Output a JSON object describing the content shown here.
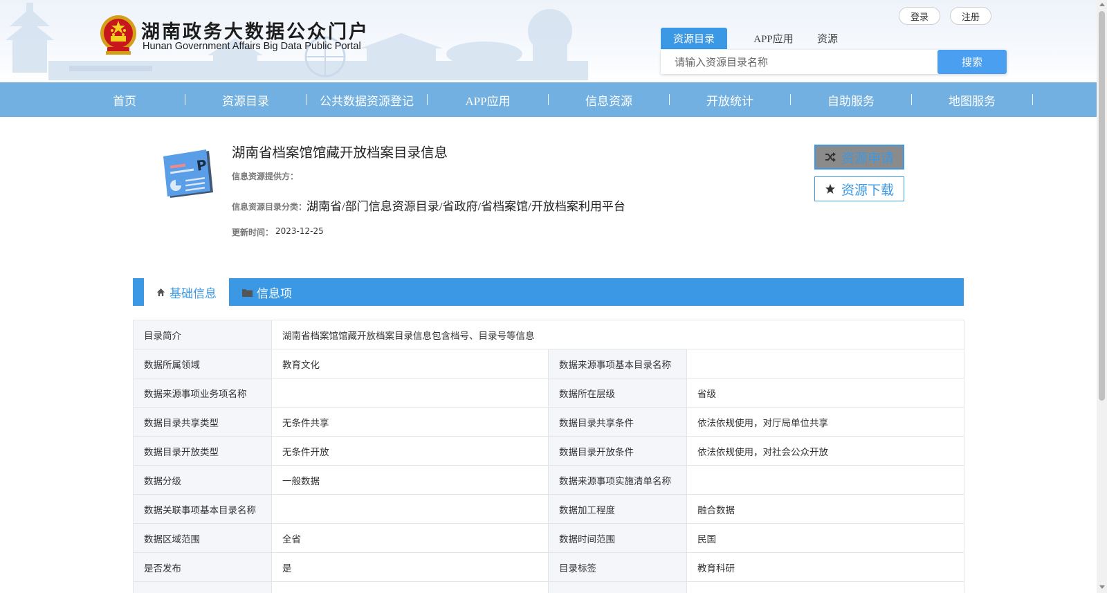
{
  "header": {
    "title": "湖南政务大数据公众门户",
    "subtitle": "Hunan Government Affairs Big Data Public Portal",
    "login_label": "登录",
    "register_label": "注册"
  },
  "search": {
    "tabs": [
      "资源目录",
      "APP应用",
      "资源"
    ],
    "active_tab": "资源目录",
    "placeholder": "请输入资源目录名称",
    "button_label": "搜索"
  },
  "nav": {
    "items": [
      "首页",
      "资源目录",
      "公共数据资源登记",
      "APP应用",
      "信息资源",
      "开放统计",
      "自助服务",
      "地图服务"
    ]
  },
  "resource": {
    "title": "湖南省档案馆馆藏开放档案目录信息",
    "provider_label": "信息资源提供方：",
    "category_label": "信息资源目录分类：",
    "category_value": "湖南省/部门信息资源目录/省政府/省档案馆/开放档案利用平台",
    "updated_label": "更新时间：",
    "updated_value": "2023-12-25",
    "apply_label": "资源申请",
    "download_label": "资源下载"
  },
  "tabs": {
    "basic_label": "基础信息",
    "items_label": "信息项"
  },
  "table": {
    "summary_label": "目录简介",
    "summary_value": "湖南省档案馆馆藏开放档案目录信息包含档号、目录号等信息",
    "rows": [
      [
        "数据所属领域",
        "教育文化",
        "数据来源事项基本目录名称",
        ""
      ],
      [
        "数据来源事项业务项名称",
        "",
        "数据所在层级",
        "省级"
      ],
      [
        "数据目录共享类型",
        "无条件共享",
        "数据目录共享条件",
        "依法依规使用，对厅局单位共享"
      ],
      [
        "数据目录开放类型",
        "无条件开放",
        "数据目录开放条件",
        "依法依规使用，对社会公众开放"
      ],
      [
        "数据分级",
        "一般数据",
        "数据来源事项实施清单名称",
        ""
      ],
      [
        "数据关联事项基本目录名称",
        "",
        "数据加工程度",
        "融合数据"
      ],
      [
        "数据区域范围",
        "全省",
        "数据时间范围",
        "民国"
      ],
      [
        "是否发布",
        "是",
        "目录标签",
        "教育科研"
      ]
    ]
  },
  "colors": {
    "primary": "#3a98e5",
    "nav_bg": "#71b0e0",
    "search_button": "#4a9ff0",
    "apply_button_bg": "#8b8b8b",
    "table_label_bg": "#f4f6f9",
    "table_border": "#e2e5ea"
  },
  "icons": {
    "emblem": "national-emblem-icon",
    "resource": "presentation-card-icon",
    "apply": "shuffle-icon",
    "download": "star-icon",
    "basic_tab": "home-icon",
    "items_tab": "folder-icon"
  }
}
